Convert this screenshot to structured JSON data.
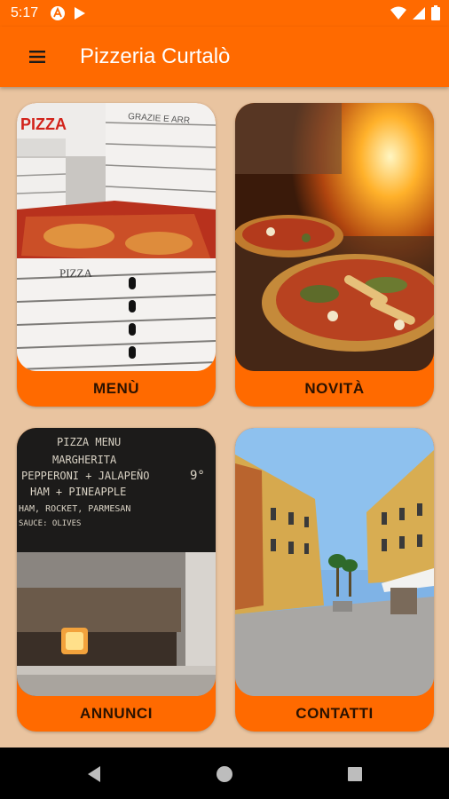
{
  "status": {
    "time": "5:17"
  },
  "app": {
    "title": "Pizzeria Curtalò"
  },
  "cards": [
    {
      "label": "MENÙ"
    },
    {
      "label": "NOVITÀ"
    },
    {
      "label": "ANNUNCI"
    },
    {
      "label": "CONTATTI"
    }
  ],
  "photo_text": {
    "pizza_box_brand": "PIZZA",
    "pizza_box_print": "PIZZA",
    "box_side_text": "GRAZIE E ARR",
    "chalk_title": "PIZZA MENU",
    "chalk_line1": "MARGHERITA",
    "chalk_line2": "PEPPERONI + JALAPEÑO",
    "chalk_line3": "HAM + PINEAPPLE",
    "chalk_line4": "HAM, ROCKET, PARMESAN",
    "chalk_line5": "SAUCE: OLIVES",
    "chalk_price": "9°"
  },
  "colors": {
    "accent": "#ff6a00",
    "background": "#e9c4a0"
  }
}
